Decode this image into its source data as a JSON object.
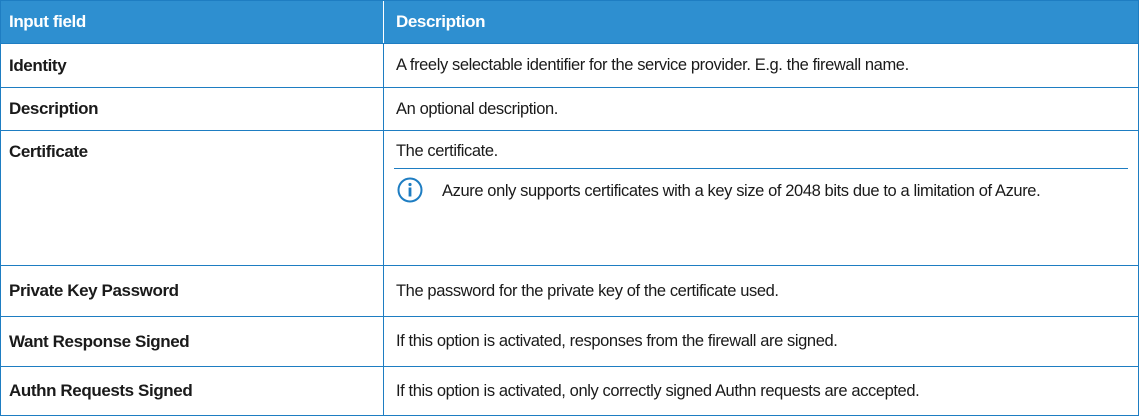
{
  "table": {
    "header": {
      "col1": "Input field",
      "col2": "Description"
    },
    "rows": [
      {
        "field": "Identity",
        "description": "A freely selectable identifier for the service provider. E.g. the firewall name."
      },
      {
        "field": "Description",
        "description": "An optional description."
      },
      {
        "field": "Certificate",
        "description": "The certificate.",
        "note": "Azure only supports certificates with a key size of 2048 bits due to a limitation of Azure.",
        "note_icon": "info-icon"
      },
      {
        "field": "Private Key Password",
        "description": "The password for the private key of the certificate used."
      },
      {
        "field": "Want Response Signed",
        "description": "If this option is activated, responses from the firewall are signed."
      },
      {
        "field": "Authn Requests Signed",
        "description": "If this option is activated, only correctly signed Authn requests are accepted."
      }
    ]
  },
  "colors": {
    "header_bg": "#2e8fd0",
    "border": "#1e7dc2",
    "icon": "#1e7dc2"
  }
}
